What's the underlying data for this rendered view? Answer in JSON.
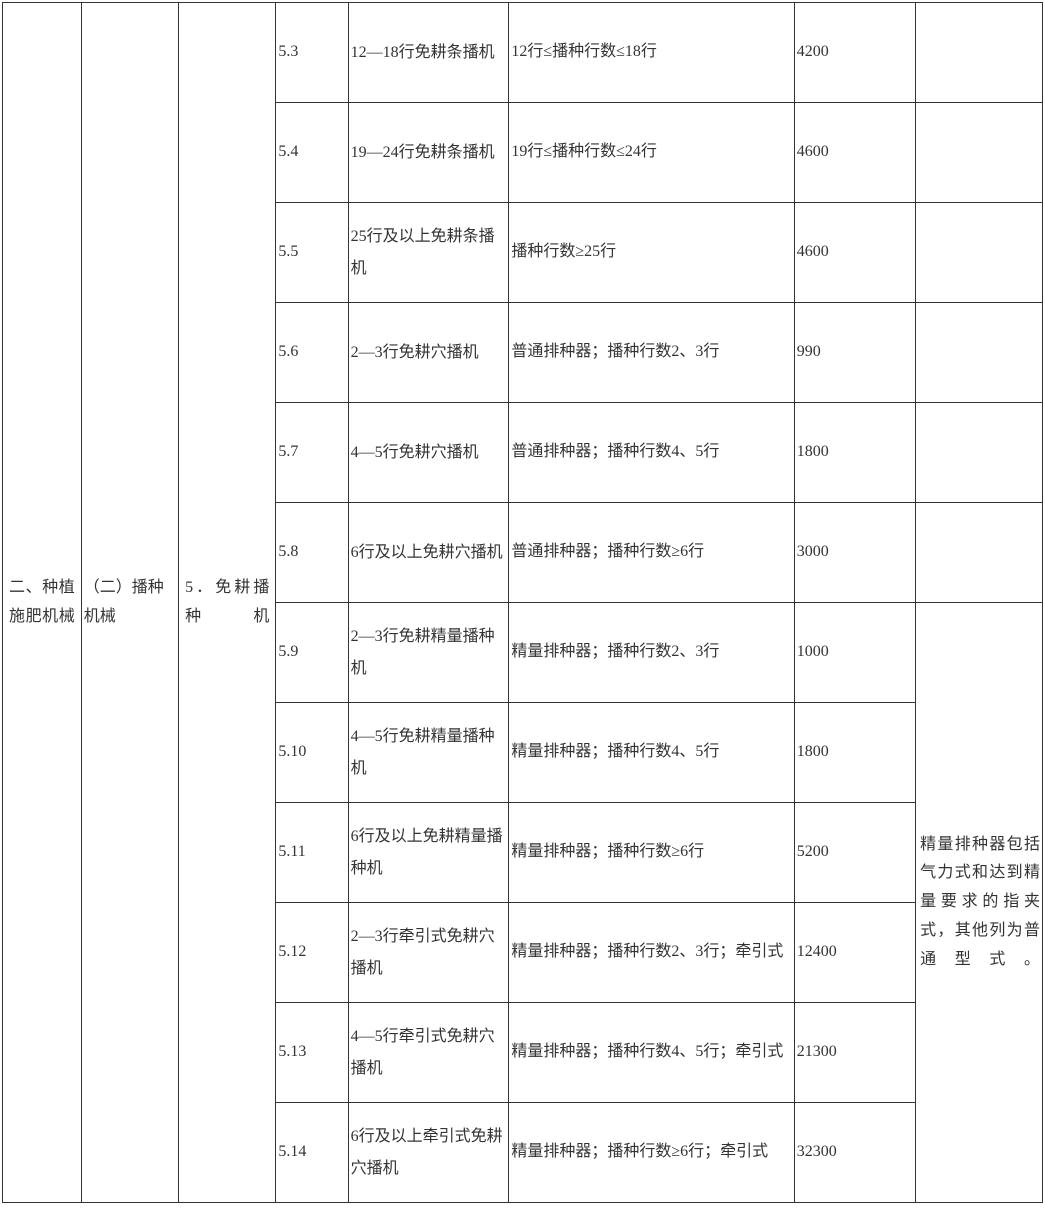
{
  "category": "二、种植施肥机械",
  "subcategory": "（二）播种机械",
  "type": "5．免耕播种机",
  "note_precision": "精量排种器包括气力式和达到精量要求的指夹式，其他列为普通型式。",
  "rows": [
    {
      "code": "5.3",
      "name": "12—18行免耕条播机",
      "spec": "12行≤播种行数≤18行",
      "price": "4200",
      "note": ""
    },
    {
      "code": "5.4",
      "name": "19—24行免耕条播机",
      "spec": "19行≤播种行数≤24行",
      "price": "4600",
      "note": ""
    },
    {
      "code": "5.5",
      "name": "25行及以上免耕条播机",
      "spec": "播种行数≥25行",
      "price": "4600",
      "note": ""
    },
    {
      "code": "5.6",
      "name": "2—3行免耕穴播机",
      "spec": "普通排种器；播种行数2、3行",
      "price": "990",
      "note": ""
    },
    {
      "code": "5.7",
      "name": "4—5行免耕穴播机",
      "spec": "普通排种器；播种行数4、5行",
      "price": "1800",
      "note": ""
    },
    {
      "code": "5.8",
      "name": "6行及以上免耕穴播机",
      "spec": "普通排种器；播种行数≥6行",
      "price": "3000",
      "note": ""
    },
    {
      "code": "5.9",
      "name": "2—3行免耕精量播种机",
      "spec": "精量排种器；播种行数2、3行",
      "price": "1000"
    },
    {
      "code": "5.10",
      "name": "4—5行免耕精量播种机",
      "spec": "精量排种器；播种行数4、5行",
      "price": "1800"
    },
    {
      "code": "5.11",
      "name": "6行及以上免耕精量播种机",
      "spec": "精量排种器；播种行数≥6行",
      "price": "5200"
    },
    {
      "code": "5.12",
      "name": "2—3行牵引式免耕穴播机",
      "spec": "精量排种器；播种行数2、3行；牵引式",
      "price": "12400"
    },
    {
      "code": "5.13",
      "name": "4—5行牵引式免耕穴播机",
      "spec": "精量排种器；播种行数4、5行；牵引式",
      "price": "21300"
    },
    {
      "code": "5.14",
      "name": "6行及以上牵引式免耕穴播机",
      "spec": "精量排种器；播种行数≥6行；牵引式",
      "price": "32300"
    }
  ]
}
